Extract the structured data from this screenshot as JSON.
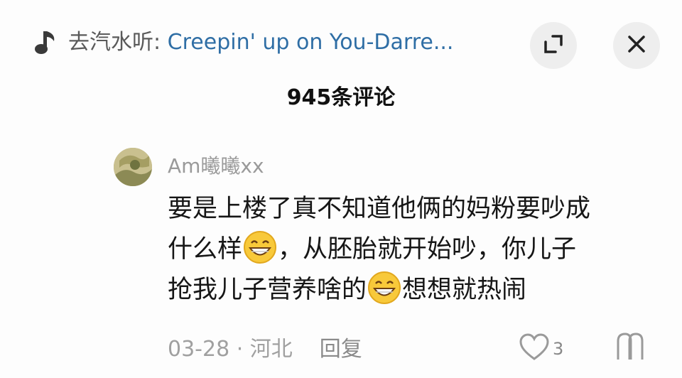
{
  "header": {
    "music_prefix": "去汽水听: ",
    "music_song": "Creepin' up on You-Darre...",
    "icons": [
      "music-note-icon",
      "expand-icon",
      "close-icon"
    ]
  },
  "comments_title": "945条评论",
  "comment": {
    "username": "Am曦曦xx",
    "text_line1": "要是上楼了真不知道他俩的妈粉要吵成",
    "text_line2a": "什么样",
    "text_line2b": "，从胚胎就开始吵，你儿子",
    "text_line3a": "抢我儿子营养啥的",
    "text_line3b": "想想就热闹",
    "emoji": "grin-emoji",
    "date": "03-28",
    "separator": " · ",
    "location": "河北",
    "reply_label": "回复",
    "like_count": "3"
  },
  "colors": {
    "song_link": "#2f6ea5",
    "muted": "#9a9a9a",
    "button_bg": "#eeeeee"
  }
}
